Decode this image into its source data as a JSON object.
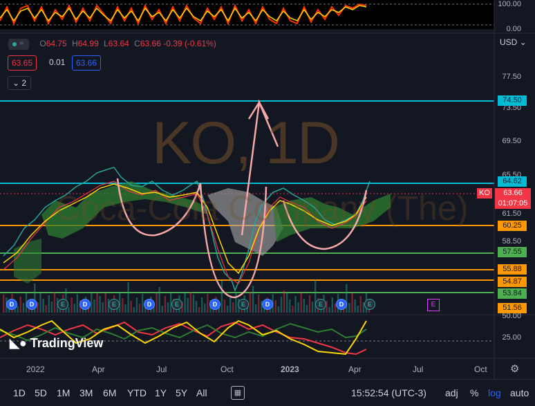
{
  "ohlc": {
    "o_label": "O",
    "o": "64.75",
    "h_label": "H",
    "h": "64.99",
    "l_label": "L",
    "l": "63.64",
    "c_label": "C",
    "c": "63.66",
    "change": "-0.39 (-0.61%)"
  },
  "bid": "63.65",
  "spread": "0.01",
  "ask": "63.66",
  "indicators_count": "2",
  "currency": "USD",
  "watermark": {
    "symbol": "KO, 1D",
    "name": "Coca-Cola Company (The)"
  },
  "top_osc_axis": [
    "100.00",
    "0.00"
  ],
  "price_axis": [
    "77.50",
    "73.50",
    "69.50",
    "65.50",
    "61.50",
    "58.50"
  ],
  "lower_osc_axis": [
    "50.00",
    "25.00"
  ],
  "levels": [
    {
      "value": "74.50",
      "color": "#00bcd4"
    },
    {
      "value": "64.62",
      "color": "#00bcd4"
    },
    {
      "value": "60.25",
      "color": "#ff9800"
    },
    {
      "value": "57.55",
      "color": "#4caf50"
    },
    {
      "value": "55.88",
      "color": "#ff9800"
    },
    {
      "value": "54.87",
      "color": "#ff9800"
    },
    {
      "value": "53.84",
      "color": "#4caf50"
    },
    {
      "value": "51.56",
      "color": "#ff9800"
    }
  ],
  "last_price": {
    "symbol": "KO",
    "value": "63.66",
    "countdown": "01:07:05"
  },
  "x_axis": [
    "2022",
    "Apr",
    "Jul",
    "Oct",
    "2023",
    "Apr",
    "Jul",
    "Oct"
  ],
  "events": {
    "dividend": "D",
    "earnings": "E"
  },
  "timeframes": [
    "1D",
    "5D",
    "1M",
    "3M",
    "6M",
    "YTD",
    "1Y",
    "5Y",
    "All"
  ],
  "clock": "15:52:54 (UTC-3)",
  "options": {
    "adj": "adj",
    "pct": "%",
    "log": "log",
    "auto": "auto"
  },
  "brand": "TradingView",
  "colors": {
    "up": "#26a69a",
    "down": "#f23645",
    "accent": "#2962ff",
    "background": "#131722"
  }
}
